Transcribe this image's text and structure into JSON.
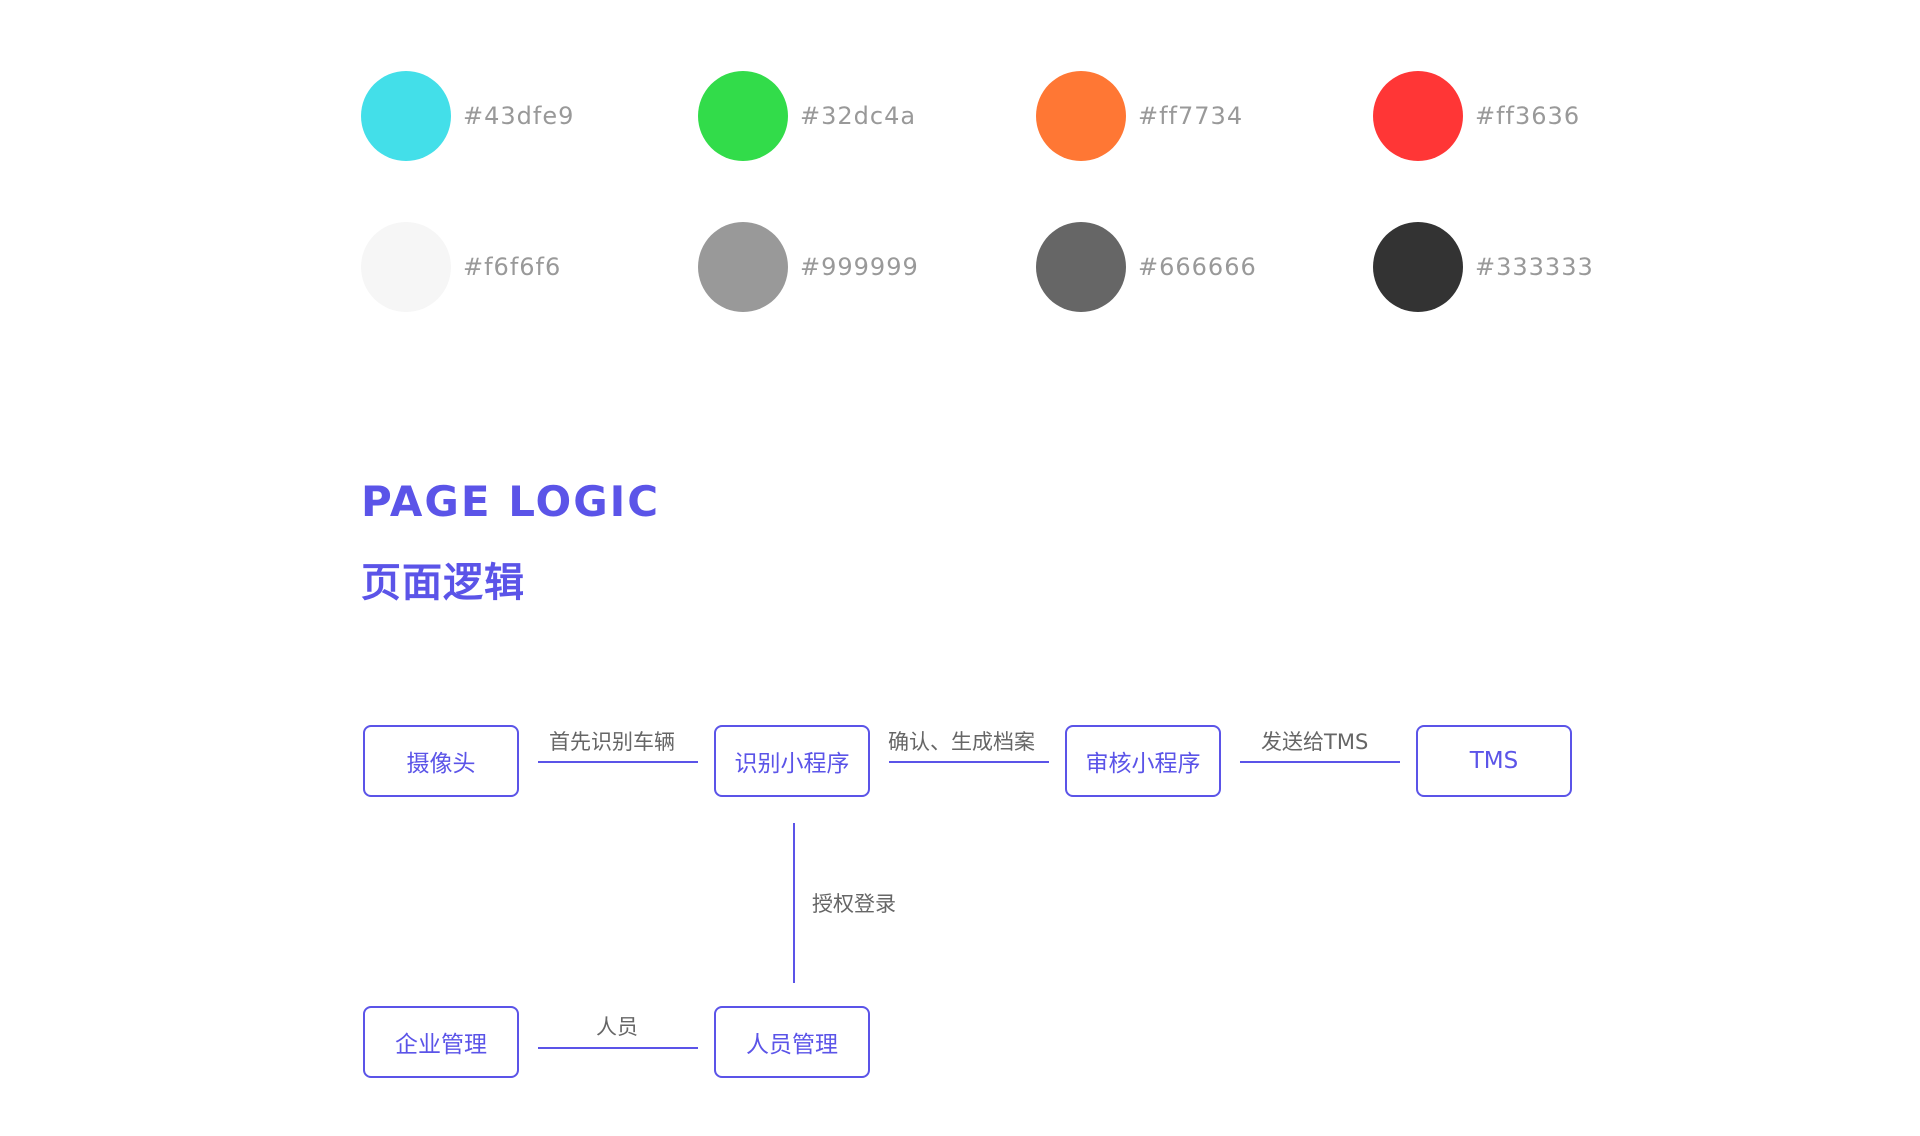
{
  "palette": [
    {
      "color": "#43dfe9",
      "label": "#43dfe9"
    },
    {
      "color": "#32dc4a",
      "label": "#32dc4a"
    },
    {
      "color": "#ff7734",
      "label": "#ff7734"
    },
    {
      "color": "#ff3636",
      "label": "#ff3636"
    },
    {
      "color": "#f6f6f6",
      "label": "#f6f6f6"
    },
    {
      "color": "#999999",
      "label": "#999999"
    },
    {
      "color": "#666666",
      "label": "#666666"
    },
    {
      "color": "#333333",
      "label": "#333333"
    }
  ],
  "section": {
    "title_en": "PAGE LOGIC",
    "title_zh": "页面逻辑"
  },
  "accent_color": "#5b54e8",
  "nodes": {
    "camera": "摄像头",
    "recognition_app": "识别小程序",
    "review_app": "审核小程序",
    "tms": "TMS",
    "enterprise": "企业管理",
    "personnel": "人员管理"
  },
  "edges": {
    "camera_to_recognition": "首先识别车辆",
    "recognition_to_review": "确认、生成档案",
    "review_to_tms": "发送给TMS",
    "recognition_to_personnel": "授权登录",
    "enterprise_to_personnel": "人员"
  }
}
